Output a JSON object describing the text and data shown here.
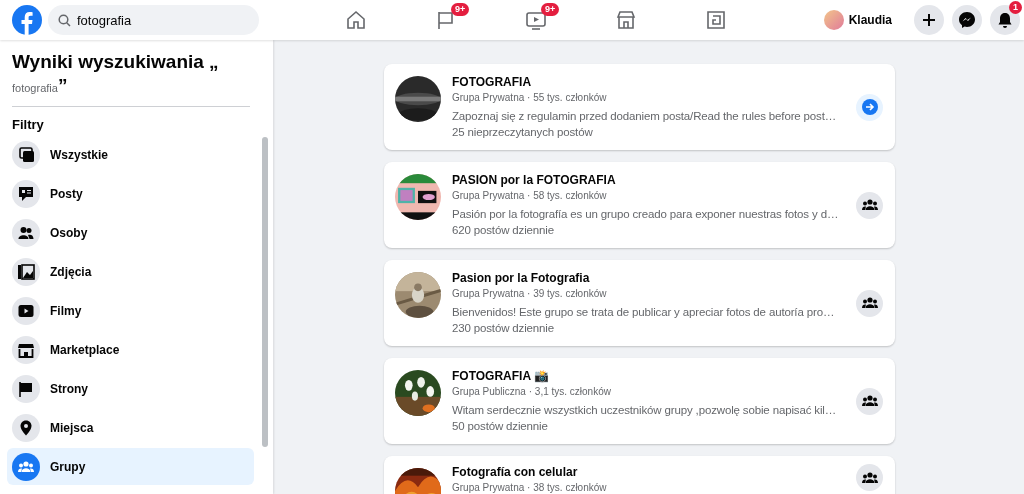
{
  "topbar": {
    "search": {
      "value": "fotografia"
    },
    "nav": [
      {
        "kind": "home"
      },
      {
        "kind": "flag",
        "badge": "9+"
      },
      {
        "kind": "video",
        "badge": "9+"
      },
      {
        "kind": "store"
      },
      {
        "kind": "gaming"
      }
    ],
    "profile": {
      "name": "Klaudia"
    },
    "actions": [
      {
        "kind": "plus"
      },
      {
        "kind": "messenger"
      },
      {
        "kind": "bell",
        "badge": "1"
      }
    ]
  },
  "sidebar": {
    "heading": {
      "prefix": "Wyniki wyszukiwania „",
      "query": "fotografia",
      "suffix": "”"
    },
    "filters_title": "Filtry",
    "filters": [
      {
        "label": "Wszystkie",
        "kind": "all",
        "selected": false
      },
      {
        "label": "Posty",
        "kind": "posts",
        "selected": false
      },
      {
        "label": "Osoby",
        "kind": "people",
        "selected": false
      },
      {
        "label": "Zdjęcia",
        "kind": "photos",
        "selected": false
      },
      {
        "label": "Filmy",
        "kind": "videos",
        "selected": false
      },
      {
        "label": "Marketplace",
        "kind": "store",
        "selected": false
      },
      {
        "label": "Strony",
        "kind": "pages",
        "selected": false
      },
      {
        "label": "Miejsca",
        "kind": "places",
        "selected": false
      },
      {
        "label": "Grupy",
        "kind": "groups",
        "selected": true
      }
    ]
  },
  "results": [
    {
      "title": "FOTOGRAFIA",
      "meta": "Grupa Prywatna · 55 tys. członków",
      "description": "Zapoznaj się z regulamin przed dodaniem posta/Read the rules before post…",
      "activity": "25 nieprzeczytanych postów",
      "button": {
        "kind": "open"
      }
    },
    {
      "title": "PASION por la FOTOGRAFIA",
      "meta": "Grupa Prywatna · 58 tys. członków",
      "description": "Pasión por la fotografía es un grupo creado para exponer nuestras fotos y d…",
      "activity": "620 postów dziennie",
      "button": {
        "kind": "join"
      }
    },
    {
      "title": "Pasion por la Fotografia",
      "meta": "Grupa Prywatna · 39 tys. członków",
      "description": "Bienvenidos! Este grupo se trata de publicar y apreciar fotos de autoría pro…",
      "activity": "230 postów dziennie",
      "button": {
        "kind": "join"
      }
    },
    {
      "title": "FOTOGRAFIA 📸",
      "meta": "Grupa Publiczna · 3,1 tys. członków",
      "description": "Witam serdecznie wszystkich uczestników grupy ,pozwolę sobie napisać kil…",
      "activity": "50 postów dziennie",
      "button": {
        "kind": "join"
      }
    },
    {
      "title": "Fotografía con celular",
      "meta": "Grupa Prywatna · 38 tys. członków",
      "button": {
        "kind": "join"
      }
    }
  ]
}
